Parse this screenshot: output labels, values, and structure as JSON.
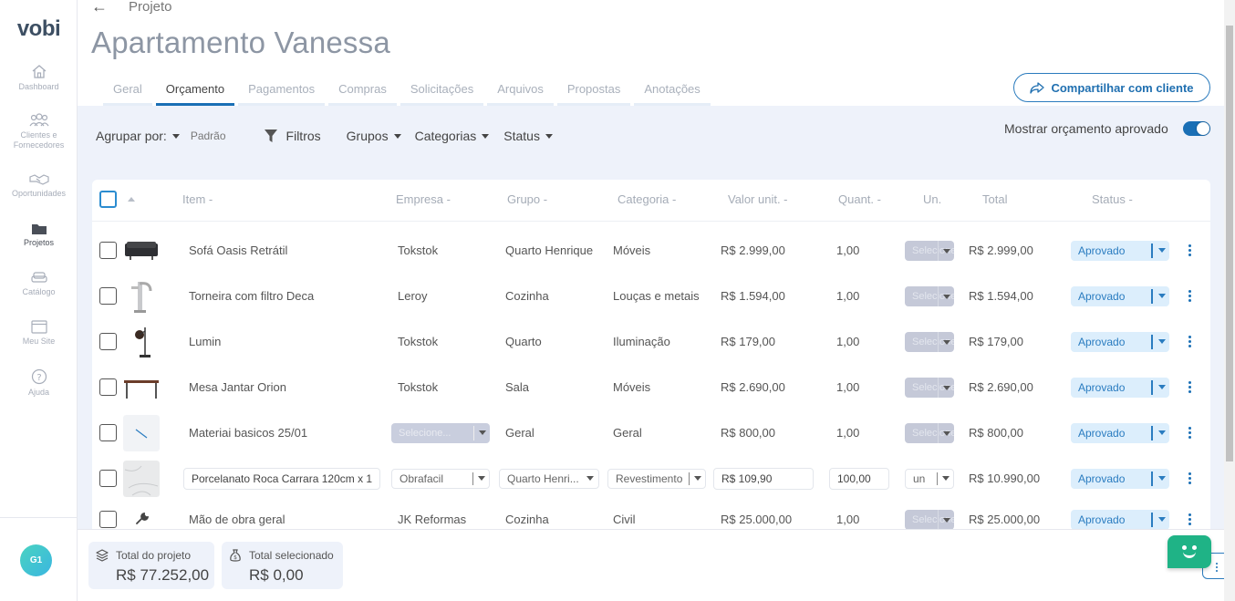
{
  "app": {
    "logo": "vobi",
    "user_initials": "G1"
  },
  "sidebar": {
    "items": [
      {
        "label": "Dashboard",
        "icon": "home-icon"
      },
      {
        "label": "Clientes e Fornecedores",
        "icon": "people-icon"
      },
      {
        "label": "Oportunidades",
        "icon": "handshake-icon"
      },
      {
        "label": "Projetos",
        "icon": "folder-icon"
      },
      {
        "label": "Catálogo",
        "icon": "sofa-icon"
      },
      {
        "label": "Meu Site",
        "icon": "browser-icon"
      },
      {
        "label": "Ajuda",
        "icon": "help-icon"
      }
    ]
  },
  "header": {
    "breadcrumb": "Projeto",
    "title": "Apartamento Vanessa",
    "share_label": "Compartilhar com cliente"
  },
  "tabs": [
    {
      "label": "Geral"
    },
    {
      "label": "Orçamento"
    },
    {
      "label": "Pagamentos"
    },
    {
      "label": "Compras"
    },
    {
      "label": "Solicitações"
    },
    {
      "label": "Arquivos"
    },
    {
      "label": "Propostas"
    },
    {
      "label": "Anotações"
    }
  ],
  "filters": {
    "group_by_label": "Agrupar por:",
    "group_by_value": "Padrão",
    "filters_label": "Filtros",
    "groups_label": "Grupos",
    "categories_label": "Categorias",
    "status_label": "Status",
    "toggle_label": "Mostrar orçamento aprovado",
    "toggle_on": true
  },
  "table": {
    "columns": [
      "Item -",
      "Empresa -",
      "Grupo -",
      "Categoria -",
      "Valor unit. -",
      "Quant. -",
      "Un.",
      "Total",
      "Status -"
    ],
    "unit_placeholder": "Selecione...",
    "rows": [
      {
        "item": "Sofá Oasis Retrátil",
        "empresa": "Tokstok",
        "grupo": "Quarto Henrique",
        "categoria": "Móveis",
        "valor": "R$ 2.999,00",
        "quant": "1,00",
        "un": "",
        "total": "R$ 2.999,00",
        "status": "Aprovado"
      },
      {
        "item": "Torneira com filtro Deca",
        "empresa": "Leroy",
        "grupo": "Cozinha",
        "categoria": "Louças e metais",
        "valor": "R$ 1.594,00",
        "quant": "1,00",
        "un": "",
        "total": "R$ 1.594,00",
        "status": "Aprovado"
      },
      {
        "item": "Lumin",
        "empresa": "Tokstok",
        "grupo": "Quarto",
        "categoria": "Iluminação",
        "valor": "R$ 179,00",
        "quant": "1,00",
        "un": "",
        "total": "R$ 179,00",
        "status": "Aprovado"
      },
      {
        "item": "Mesa Jantar Orion",
        "empresa": "Tokstok",
        "grupo": "Sala",
        "categoria": "Móveis",
        "valor": "R$ 2.690,00",
        "quant": "1,00",
        "un": "",
        "total": "R$ 2.690,00",
        "status": "Aprovado"
      },
      {
        "item": "Materiai basicos 25/01",
        "empresa": "Selecione...",
        "grupo": "Geral",
        "categoria": "Geral",
        "valor": "R$ 800,00",
        "quant": "1,00",
        "un": "",
        "total": "R$ 800,00",
        "status": "Aprovado"
      },
      {
        "item": "Porcelanato Roca Carrara 120cm x 1",
        "empresa": "Obrafacil",
        "grupo": "Quarto Henri...",
        "categoria": "Revestimento",
        "valor": "R$ 109,90",
        "quant": "100,00",
        "un": "un",
        "total": "R$ 10.990,00",
        "status": "Aprovado"
      },
      {
        "item": "Mão de obra geral",
        "empresa": "JK Reformas",
        "grupo": "Cozinha",
        "categoria": "Civil",
        "valor": "R$ 25.000,00",
        "quant": "1,00",
        "un": "",
        "total": "R$ 25.000,00",
        "status": "Aprovado"
      }
    ]
  },
  "footer": {
    "total_label": "Total do projeto",
    "total_value": "R$ 77.252,00",
    "selected_label": "Total selecionado",
    "selected_value": "R$ 0,00"
  },
  "colors": {
    "accent": "#1a6fb5",
    "band": "#eef2fa",
    "status_bg": "#dceefc",
    "chat": "#1fb386"
  }
}
